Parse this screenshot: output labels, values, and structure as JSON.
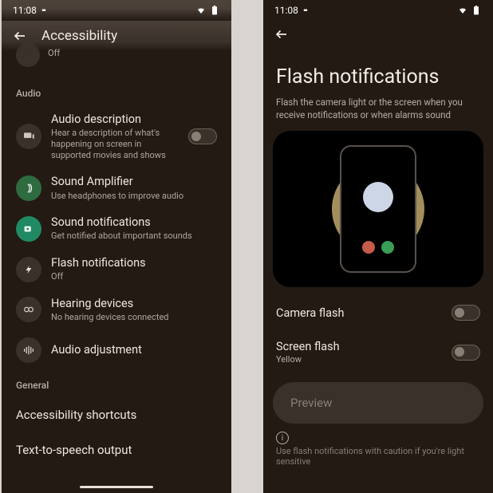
{
  "status": {
    "time": "11:08",
    "wifi": "wifi",
    "battery": "battery"
  },
  "left": {
    "title": "Accessibility",
    "prev_sub": "Off",
    "section_audio": "Audio",
    "section_general": "General",
    "audio_desc": {
      "title": "Audio description",
      "sub": "Hear a description of what's happening on screen in supported movies and shows"
    },
    "sound_amp": {
      "title": "Sound Amplifier",
      "sub": "Use headphones to improve audio"
    },
    "sound_notif": {
      "title": "Sound notifications",
      "sub": "Get notified about important sounds"
    },
    "flash_notif": {
      "title": "Flash notifications",
      "sub": "Off"
    },
    "hearing": {
      "title": "Hearing devices",
      "sub": "No hearing devices connected"
    },
    "audio_adj": {
      "title": "Audio adjustment"
    },
    "shortcuts": "Accessibility shortcuts",
    "tts": "Text-to-speech output"
  },
  "right": {
    "title": "Flash notifications",
    "desc": "Flash the camera light or the screen when you receive notifications or when alarms sound",
    "camera_flash": "Camera flash",
    "screen_flash": "Screen flash",
    "screen_flash_sub": "Yellow",
    "preview": "Preview",
    "footer": "Use flash notifications with caution if you're light sensitive"
  }
}
